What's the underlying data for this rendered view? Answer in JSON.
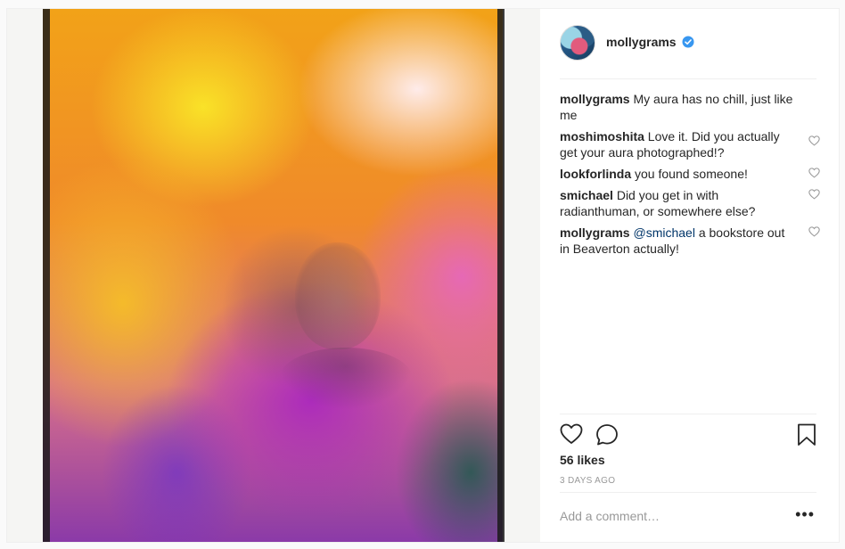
{
  "post": {
    "username": "mollygrams",
    "verified": true,
    "image_alt": "Aura photograph",
    "comments": [
      {
        "user": "mollygrams",
        "text": "My aura has no chill, just like me",
        "has_like": false
      },
      {
        "user": "moshimoshita",
        "text": "Love it. Did you actually get your aura photographed!?",
        "has_like": true
      },
      {
        "user": "lookforlinda",
        "text": "you found someone!",
        "has_like": true
      },
      {
        "user": "smichael",
        "text": "Did you get in with radianthuman, or somewhere else?",
        "has_like": true
      },
      {
        "user": "mollygrams",
        "mention": "@smichael",
        "text": "a bookstore out in Beaverton actually!",
        "has_like": true
      }
    ],
    "likes": "56 likes",
    "time": "3 DAYS AGO",
    "add_comment_placeholder": "Add a comment…",
    "more_label": "•••"
  },
  "icons": {
    "like": "heart-icon",
    "comment": "comment-icon",
    "save": "bookmark-icon",
    "verified": "verified-badge-icon",
    "comment_like": "heart-icon"
  },
  "colors": {
    "verified": "#3897f0",
    "mention": "#003569"
  }
}
